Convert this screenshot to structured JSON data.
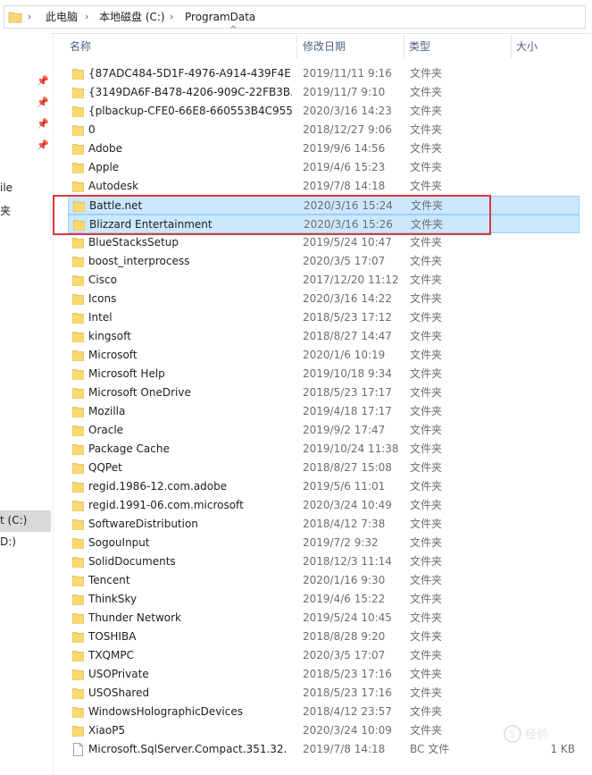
{
  "address": {
    "crumbs": [
      "此电脑",
      "本地磁盘 (C:)",
      "ProgramData"
    ]
  },
  "nav": {
    "labels": [
      "ile",
      "夹",
      "t (C:)",
      "D:)"
    ]
  },
  "header": {
    "name": "名称",
    "date": "修改日期",
    "type": "类型",
    "size": "大小"
  },
  "rows": [
    {
      "name": "{87ADC484-5D1F-4976-A914-439F4E...",
      "date": "2019/11/11 9:16",
      "type": "文件夹",
      "size": ""
    },
    {
      "name": "{3149DA6F-B478-4206-909C-22FB3B...",
      "date": "2019/11/7 9:10",
      "type": "文件夹",
      "size": ""
    },
    {
      "name": "{plbackup-CFE0-66E8-660553B4C955}",
      "date": "2020/3/16 14:23",
      "type": "文件夹",
      "size": ""
    },
    {
      "name": "0",
      "date": "2018/12/27 9:06",
      "type": "文件夹",
      "size": ""
    },
    {
      "name": "Adobe",
      "date": "2019/9/6 14:56",
      "type": "文件夹",
      "size": ""
    },
    {
      "name": "Apple",
      "date": "2019/4/6 15:23",
      "type": "文件夹",
      "size": ""
    },
    {
      "name": "Autodesk",
      "date": "2019/7/8 14:18",
      "type": "文件夹",
      "size": ""
    },
    {
      "name": "Battle.net",
      "date": "2020/3/16 15:24",
      "type": "文件夹",
      "size": ""
    },
    {
      "name": "Blizzard Entertainment",
      "date": "2020/3/16 15:26",
      "type": "文件夹",
      "size": ""
    },
    {
      "name": "BlueStacksSetup",
      "date": "2019/5/24 10:47",
      "type": "文件夹",
      "size": ""
    },
    {
      "name": "boost_interprocess",
      "date": "2020/3/5 17:07",
      "type": "文件夹",
      "size": ""
    },
    {
      "name": "Cisco",
      "date": "2017/12/20 11:12",
      "type": "文件夹",
      "size": ""
    },
    {
      "name": "Icons",
      "date": "2020/3/16 14:22",
      "type": "文件夹",
      "size": ""
    },
    {
      "name": "Intel",
      "date": "2018/5/23 17:12",
      "type": "文件夹",
      "size": ""
    },
    {
      "name": "kingsoft",
      "date": "2018/8/27 14:47",
      "type": "文件夹",
      "size": ""
    },
    {
      "name": "Microsoft",
      "date": "2020/1/6 10:19",
      "type": "文件夹",
      "size": ""
    },
    {
      "name": "Microsoft Help",
      "date": "2019/10/18 9:34",
      "type": "文件夹",
      "size": ""
    },
    {
      "name": "Microsoft OneDrive",
      "date": "2018/5/23 17:17",
      "type": "文件夹",
      "size": ""
    },
    {
      "name": "Mozilla",
      "date": "2019/4/18 17:17",
      "type": "文件夹",
      "size": ""
    },
    {
      "name": "Oracle",
      "date": "2019/9/2 17:47",
      "type": "文件夹",
      "size": ""
    },
    {
      "name": "Package Cache",
      "date": "2019/10/24 11:38",
      "type": "文件夹",
      "size": ""
    },
    {
      "name": "QQPet",
      "date": "2018/8/27 15:08",
      "type": "文件夹",
      "size": ""
    },
    {
      "name": "regid.1986-12.com.adobe",
      "date": "2019/5/6 11:01",
      "type": "文件夹",
      "size": ""
    },
    {
      "name": "regid.1991-06.com.microsoft",
      "date": "2020/3/24 10:49",
      "type": "文件夹",
      "size": ""
    },
    {
      "name": "SoftwareDistribution",
      "date": "2018/4/12 7:38",
      "type": "文件夹",
      "size": ""
    },
    {
      "name": "SogouInput",
      "date": "2019/7/2 9:32",
      "type": "文件夹",
      "size": ""
    },
    {
      "name": "SolidDocuments",
      "date": "2018/12/3 11:14",
      "type": "文件夹",
      "size": ""
    },
    {
      "name": "Tencent",
      "date": "2020/1/16 9:30",
      "type": "文件夹",
      "size": ""
    },
    {
      "name": "ThinkSky",
      "date": "2019/4/6 15:22",
      "type": "文件夹",
      "size": ""
    },
    {
      "name": "Thunder Network",
      "date": "2019/5/24 10:45",
      "type": "文件夹",
      "size": ""
    },
    {
      "name": "TOSHIBA",
      "date": "2018/8/28 9:20",
      "type": "文件夹",
      "size": ""
    },
    {
      "name": "TXQMPC",
      "date": "2020/3/5 17:07",
      "type": "文件夹",
      "size": ""
    },
    {
      "name": "USOPrivate",
      "date": "2018/5/23 17:16",
      "type": "文件夹",
      "size": ""
    },
    {
      "name": "USOShared",
      "date": "2018/5/23 17:16",
      "type": "文件夹",
      "size": ""
    },
    {
      "name": "WindowsHolographicDevices",
      "date": "2018/4/12 23:57",
      "type": "文件夹",
      "size": ""
    },
    {
      "name": "XiaoP5",
      "date": "2020/3/24 10:09",
      "type": "文件夹",
      "size": ""
    },
    {
      "name": "Microsoft.SqlServer.Compact.351.32.",
      "date": "2019/7/8 14:18",
      "type": "BC 文件",
      "size": "1 KB",
      "file": true
    }
  ],
  "selected_rows": [
    7,
    8
  ],
  "watermark": "经验"
}
